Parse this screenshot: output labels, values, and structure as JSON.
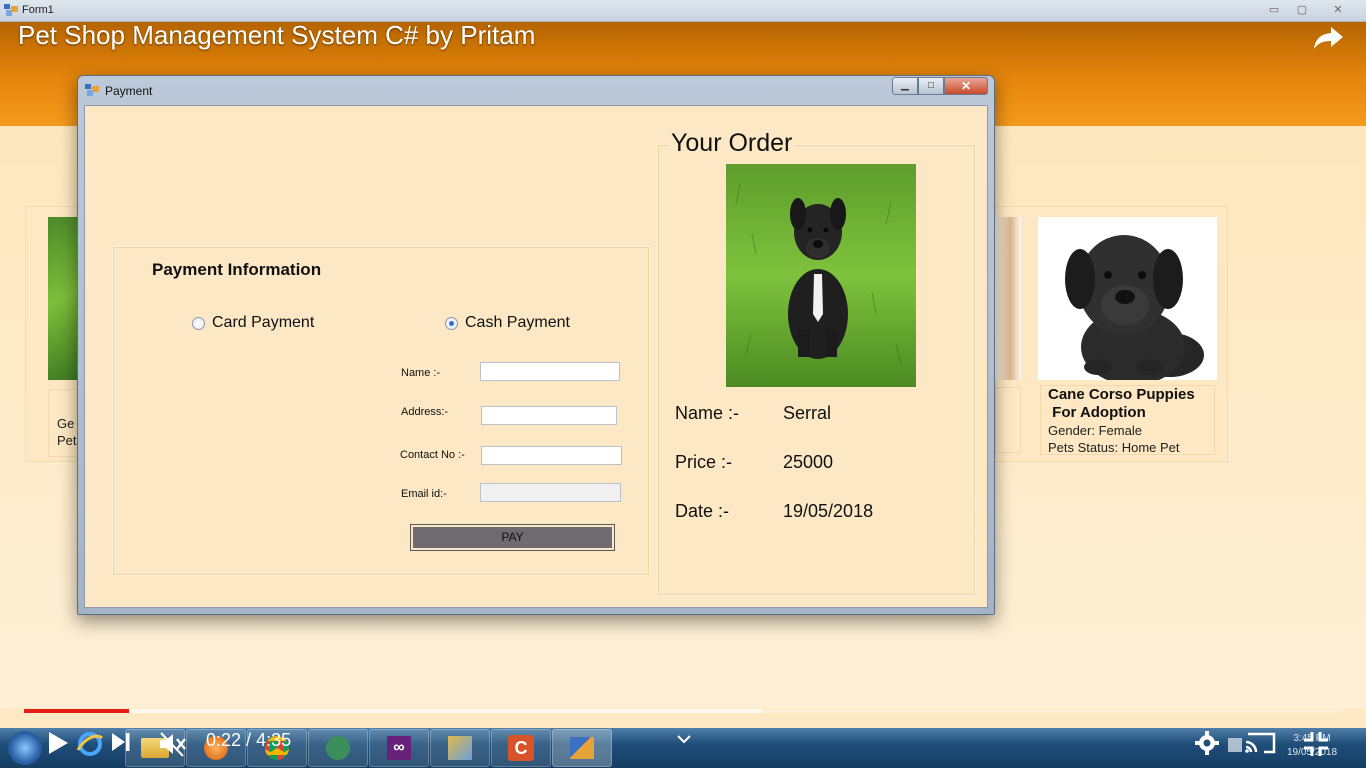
{
  "background_window": {
    "title": "Form1",
    "controls": [
      "▭",
      "▢",
      "✕"
    ]
  },
  "video": {
    "title": "Pet Shop Management System C# by Pritam",
    "share_icon": "share-arrow-icon",
    "current_time": "0:22",
    "separator": " / ",
    "duration": "4:35",
    "progress_played": 0.08,
    "progress_buffered": 0.56,
    "accent_color": "#e61e14"
  },
  "pets": {
    "left_card_fragment": {
      "line1": "Ge",
      "line2": "Pet"
    },
    "card": {
      "name_line1": "Cane Corso Puppies",
      "name_line2": " For Adoption",
      "gender": "Gender: Female",
      "status": "Pets Status: Home Pet"
    }
  },
  "payment_dialog": {
    "title": "Payment",
    "payment_info": {
      "heading": "Payment Information",
      "card_option": "Card Payment",
      "cash_option": "Cash Payment",
      "selected": "cash",
      "name_label": "Name :-",
      "address_label": "Address:-",
      "contact_label": "Contact No :-",
      "email_label": "Email id:-",
      "name_value": "",
      "address_value": "",
      "contact_value": "",
      "email_value": "",
      "pay_button": "PAY"
    },
    "order": {
      "heading": "Your Order",
      "name_label": "Name :-",
      "name_value": "Serral",
      "price_label": "Price :-",
      "price_value": "25000",
      "date_label": "Date :-",
      "date_value": "19/05/2018"
    }
  },
  "taskbar": {
    "clock_time": "3:45 PM",
    "clock_date": "19/05/2018",
    "apps": [
      "start-orb-icon",
      "ie-icon",
      "file-explorer-icon",
      "media-player-icon",
      "chrome-icon",
      "android-studio-icon",
      "visual-studio-icon",
      "network-tool-icon",
      "camtasia-icon",
      "winforms-app-icon"
    ]
  }
}
